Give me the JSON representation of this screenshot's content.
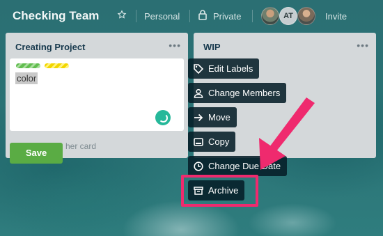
{
  "header": {
    "board_title": "Checking Team",
    "team_label": "Personal",
    "visibility_label": "Private",
    "member_initials": "AT",
    "invite_label": "Invite"
  },
  "lists": [
    {
      "title": "Creating Project",
      "menu_icon": "ellipsis-icon",
      "card": {
        "label_colors": [
          "#61bd4f",
          "#f2d600"
        ],
        "text": "color"
      },
      "add_card_text": "her card",
      "save_label": "Save"
    },
    {
      "title": "WIP",
      "menu_icon": "ellipsis-icon"
    }
  ],
  "card_menu": {
    "items": [
      {
        "label": "Edit Labels",
        "icon": "tag-icon"
      },
      {
        "label": "Change Members",
        "icon": "person-icon"
      },
      {
        "label": "Move",
        "icon": "arrow-right-icon"
      },
      {
        "label": "Copy",
        "icon": "card-icon"
      },
      {
        "label": "Change Due Date",
        "icon": "clock-icon"
      },
      {
        "label": "Archive",
        "icon": "archive-icon"
      }
    ]
  },
  "annotation": {
    "highlight_color": "#ef2a6e"
  }
}
